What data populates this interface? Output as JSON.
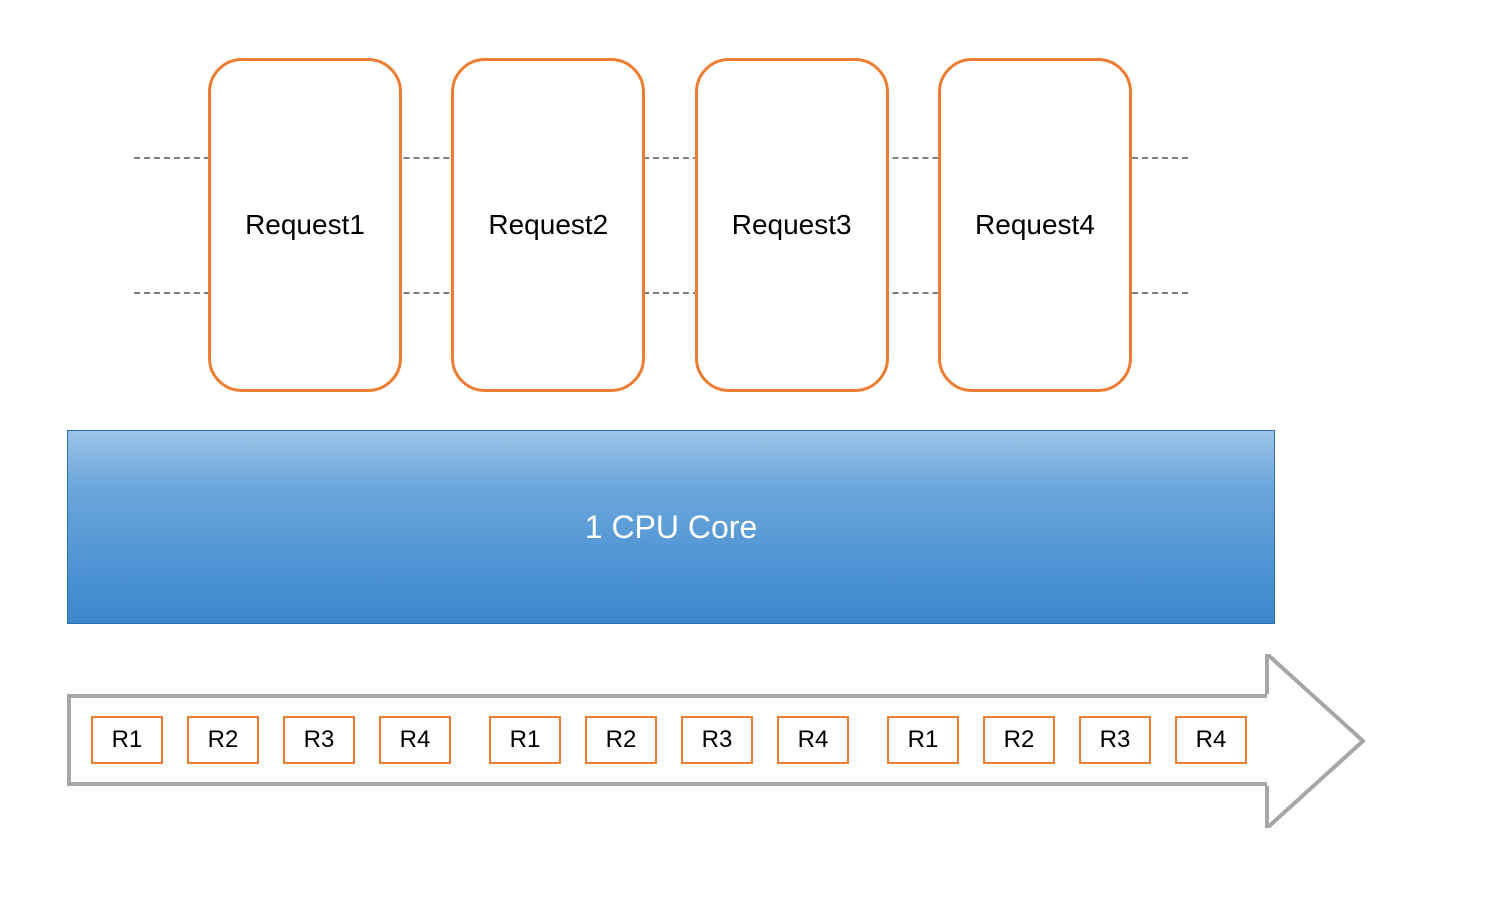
{
  "requests": [
    {
      "label": "Request1"
    },
    {
      "label": "Request2"
    },
    {
      "label": "Request3"
    },
    {
      "label": "Request4"
    }
  ],
  "cpu": {
    "label": "1 CPU Core"
  },
  "timeline": {
    "groups": [
      [
        "R1",
        "R2",
        "R3",
        "R4"
      ],
      [
        "R1",
        "R2",
        "R3",
        "R4"
      ],
      [
        "R1",
        "R2",
        "R3",
        "R4"
      ]
    ]
  },
  "colors": {
    "orange": "#ED7D31",
    "blue": "#4F94D4",
    "grey": "#A6A6A6"
  }
}
